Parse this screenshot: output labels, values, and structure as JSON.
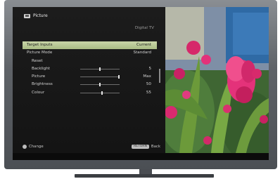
{
  "menu": {
    "title": "Picture",
    "title_icon": "picture-icon",
    "source": "Digital TV",
    "items": [
      {
        "label": "Target Inputs",
        "value": "Current",
        "selected": true
      },
      {
        "label": "Picture Mode",
        "value": "Standard"
      },
      {
        "label": "Reset",
        "value": ""
      },
      {
        "label": "Backlight",
        "value": "5",
        "level": 0.5
      },
      {
        "label": "Picture",
        "value": "Max",
        "level": 1.0
      },
      {
        "label": "Brightness",
        "value": "50",
        "level": 0.5
      },
      {
        "label": "Colour",
        "value": "55",
        "level": 0.55
      }
    ]
  },
  "footer": {
    "change_label": "Change",
    "return_key": "RETURN",
    "back_label": "Back"
  },
  "colors": {
    "highlight": "#b9c894",
    "panel": "#181818",
    "bezel": "#0b0b0b",
    "tv_frame": "#5f6368"
  }
}
